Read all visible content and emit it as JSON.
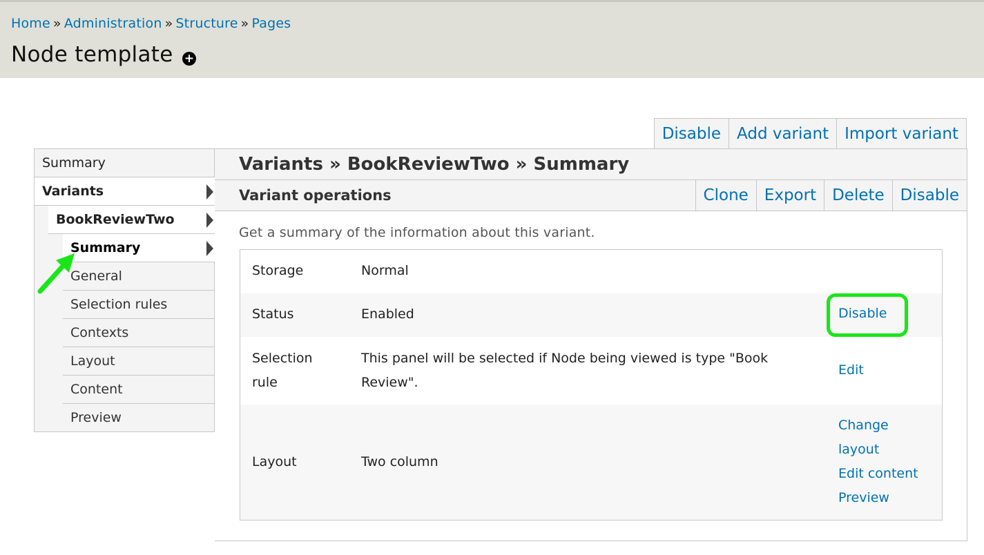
{
  "breadcrumb": {
    "items": [
      "Home",
      "Administration",
      "Structure",
      "Pages"
    ],
    "separator": "»"
  },
  "page_title": "Node template",
  "top_actions": [
    "Disable",
    "Add variant",
    "Import variant"
  ],
  "nav": {
    "summary": "Summary",
    "variants": "Variants",
    "variant_name": "BookReviewTwo",
    "sub_items": [
      "Summary",
      "General",
      "Selection rules",
      "Contexts",
      "Layout",
      "Content",
      "Preview"
    ]
  },
  "panel": {
    "title": "Variants » BookReviewTwo » Summary",
    "ops_title": "Variant operations",
    "ops_buttons": [
      "Clone",
      "Export",
      "Delete",
      "Disable"
    ],
    "description": "Get a summary of the information about this variant."
  },
  "summary_table": {
    "storage": {
      "label": "Storage",
      "value": "Normal"
    },
    "status": {
      "label": "Status",
      "value": "Enabled",
      "action": "Disable"
    },
    "selection": {
      "label_line1": "Selection",
      "label_line2": "rule",
      "value_line1": "This panel will be selected if Node being viewed is type \"Book",
      "value_line2": "Review\".",
      "action": "Edit"
    },
    "layout": {
      "label": "Layout",
      "value": "Two column",
      "actions": [
        "Change",
        "layout",
        "Edit content",
        "Preview"
      ]
    }
  },
  "colors": {
    "link": "#0071b3",
    "header_bg": "#e0e0d8",
    "annotation": "#19e619"
  }
}
